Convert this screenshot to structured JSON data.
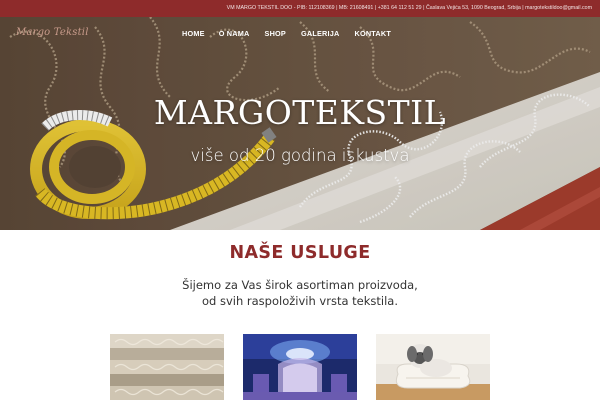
{
  "topbar": {
    "info": "VM MARGO TEKSTIL DOO - PIB: 112108369 | MB: 21608491 | +381 64 112 51 29 | Časlava Vejića 53, 1090 Beograd, Srbija | margotekstildoo@gmail.com"
  },
  "logo": {
    "text": "Margo Tekstil"
  },
  "nav": {
    "items": [
      {
        "label": "HOME"
      },
      {
        "label": "O NAMA"
      },
      {
        "label": "SHOP"
      },
      {
        "label": "GALERIJA"
      },
      {
        "label": "KONTAKT"
      }
    ]
  },
  "hero": {
    "title": "MARGOTEKSTIL",
    "subtitle": "više od 20 godina iskustva"
  },
  "services": {
    "title": "NAŠE USLUGE",
    "line1": "Šijemo za Vas širok asortiman proizvoda,",
    "line2": "od svih raspoloživih vrsta tekstila."
  },
  "colors": {
    "brand": "#8e2b2b",
    "topbar_text": "#f3e6e6",
    "hero_text": "#ffffff",
    "body_text": "#333333"
  }
}
